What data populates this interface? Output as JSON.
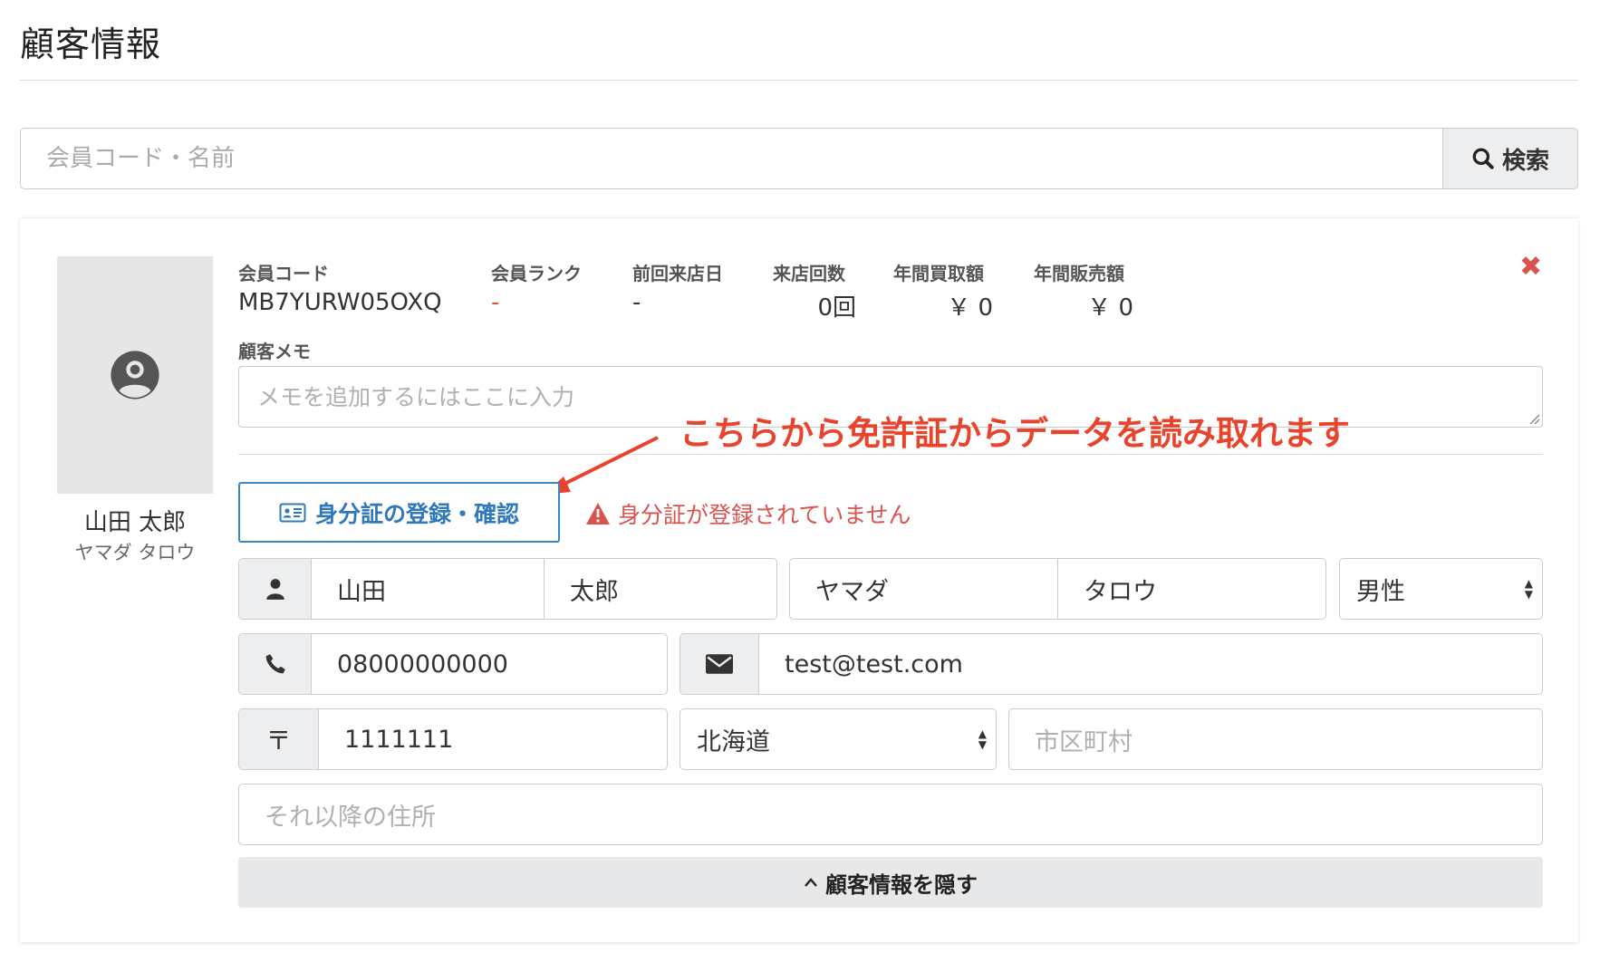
{
  "page": {
    "title": "顧客情報"
  },
  "search": {
    "placeholder": "会員コード・名前",
    "button_label": "検索"
  },
  "customer": {
    "name": "山田 太郎",
    "kana": "ヤマダ タロウ",
    "stats": [
      {
        "label": "会員コード",
        "value": "MB7YURW05OXQ"
      },
      {
        "label": "会員ランク",
        "value": "-"
      },
      {
        "label": "前回来店日",
        "value": "-"
      },
      {
        "label": "来店回数",
        "value": "0回"
      },
      {
        "label": "年間買取額",
        "value": "￥ 0"
      },
      {
        "label": "年間販売額",
        "value": "￥ 0"
      }
    ],
    "memo_label": "顧客メモ",
    "memo_placeholder": "メモを追加するにはここに入力"
  },
  "annotation": {
    "text": "こちらから免許証からデータを読み取れます",
    "color": "#e8442d"
  },
  "id_card": {
    "button_label": "身分証の登録・確認",
    "warning": "身分証が登録されていません"
  },
  "form": {
    "last_name": "山田",
    "first_name": "太郎",
    "last_name_kana": "ヤマダ",
    "first_name_kana": "タロウ",
    "gender": "男性",
    "phone": "08000000000",
    "email": "test@test.com",
    "postal_mark": "〒",
    "postal_code": "1111111",
    "prefecture": "北海道",
    "city_placeholder": "市区町村",
    "address_placeholder": "それ以降の住所"
  },
  "toggle": {
    "label": "顧客情報を隠す"
  },
  "icons": [
    "search-icon",
    "user-circle-icon",
    "close-icon",
    "id-card-icon",
    "warning-icon",
    "user-icon",
    "phone-icon",
    "envelope-icon",
    "chevron-up-icon"
  ],
  "colors": {
    "accent": "#3a87c8",
    "danger": "#d9534f",
    "annotation": "#e8442d"
  }
}
